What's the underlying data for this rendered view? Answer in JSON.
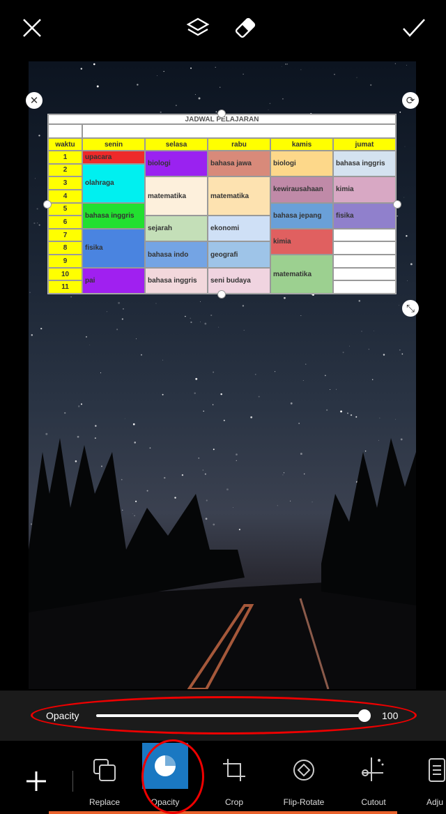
{
  "topbar": {
    "close": "close-icon",
    "layers": "layers-icon",
    "eraser": "eraser-icon",
    "apply": "check-icon"
  },
  "schedule": {
    "title": "JADWAL PELAJARAN",
    "headers": [
      "waktu",
      "senin",
      "selasa",
      "rabu",
      "kamis",
      "jumat"
    ],
    "periods": [
      "1",
      "2",
      "3",
      "4",
      "5",
      "6",
      "7",
      "8",
      "9",
      "10",
      "11"
    ],
    "columns": [
      [
        {
          "subject": "upacara",
          "from": 1,
          "to": 1,
          "color": "#ee2a2a"
        },
        {
          "subject": "olahraga",
          "from": 2,
          "to": 4,
          "color": "#00f0f0"
        },
        {
          "subject": "bahasa inggris",
          "from": 5,
          "to": 6,
          "color": "#22e030"
        },
        {
          "subject": "fisika",
          "from": 7,
          "to": 9,
          "color": "#4a84e0"
        },
        {
          "subject": "pai",
          "from": 10,
          "to": 11,
          "color": "#a020f0"
        }
      ],
      [
        {
          "subject": "biologi",
          "from": 1,
          "to": 2,
          "color": "#9a22f0"
        },
        {
          "subject": "matematika",
          "from": 3,
          "to": 5,
          "color": "#fdf0dc"
        },
        {
          "subject": "sejarah",
          "from": 6,
          "to": 7,
          "color": "#c4dfb8"
        },
        {
          "subject": "bahasa indo",
          "from": 8,
          "to": 9,
          "color": "#74a4e4"
        },
        {
          "subject": "bahasa inggris",
          "from": 10,
          "to": 11,
          "color": "#f2d8dc"
        }
      ],
      [
        {
          "subject": "bahasa jawa",
          "from": 1,
          "to": 2,
          "color": "#d88a7a"
        },
        {
          "subject": "matematika",
          "from": 3,
          "to": 5,
          "color": "#fde2b0"
        },
        {
          "subject": "ekonomi",
          "from": 6,
          "to": 7,
          "color": "#cfe0f6"
        },
        {
          "subject": "geografi",
          "from": 8,
          "to": 9,
          "color": "#9ec4e8"
        },
        {
          "subject": "seni budaya",
          "from": 10,
          "to": 11,
          "color": "#f0d4e0"
        }
      ],
      [
        {
          "subject": "biologi",
          "from": 1,
          "to": 2,
          "color": "#fdd88a"
        },
        {
          "subject": "kewirausahaan",
          "from": 3,
          "to": 4,
          "color": "#c08aa8"
        },
        {
          "subject": "bahasa jepang",
          "from": 5,
          "to": 6,
          "color": "#6aa0d8"
        },
        {
          "subject": "kimia",
          "from": 7,
          "to": 8,
          "color": "#e06060"
        },
        {
          "subject": "matematika",
          "from": 9,
          "to": 11,
          "color": "#9cd090"
        }
      ],
      [
        {
          "subject": "bahasa inggris",
          "from": 1,
          "to": 2,
          "color": "#d4e2f0"
        },
        {
          "subject": "kimia",
          "from": 3,
          "to": 4,
          "color": "#d8a8c4"
        },
        {
          "subject": "fisika",
          "from": 5,
          "to": 6,
          "color": "#9080cc"
        },
        {
          "subject": "",
          "from": 7,
          "to": 7,
          "color": "#ffffff"
        },
        {
          "subject": "",
          "from": 8,
          "to": 8,
          "color": "#ffffff"
        },
        {
          "subject": "",
          "from": 9,
          "to": 9,
          "color": "#ffffff"
        },
        {
          "subject": "",
          "from": 10,
          "to": 10,
          "color": "#ffffff"
        },
        {
          "subject": "",
          "from": 11,
          "to": 11,
          "color": "#ffffff"
        }
      ]
    ]
  },
  "opacity": {
    "label": "Opacity",
    "value": "100",
    "percent": 100
  },
  "toolbar": {
    "add": "plus-icon",
    "items": [
      {
        "label": "Replace",
        "icon": "replace-icon"
      },
      {
        "label": "Opacity",
        "icon": "opacity-icon",
        "active": true
      },
      {
        "label": "Crop",
        "icon": "crop-icon"
      },
      {
        "label": "Flip-Rotate",
        "icon": "flip-rotate-icon"
      },
      {
        "label": "Cutout",
        "icon": "cutout-icon"
      },
      {
        "label": "Adju",
        "icon": "adjust-icon"
      }
    ]
  },
  "colors": {
    "accent": "#1a78c2",
    "highlight": "#e00000",
    "underline": "#e8622c"
  }
}
